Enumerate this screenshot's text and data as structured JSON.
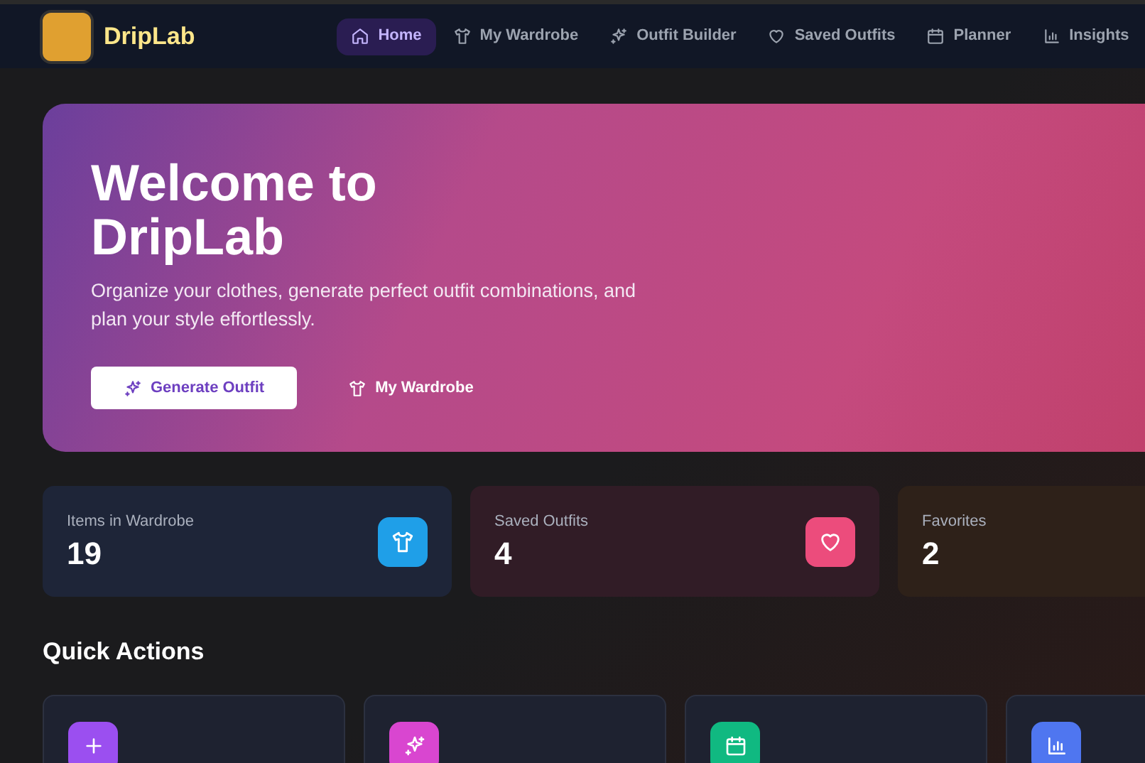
{
  "brand": {
    "name": "DripLab"
  },
  "nav": [
    {
      "label": "Home",
      "selected": true
    },
    {
      "label": "My Wardrobe",
      "selected": false
    },
    {
      "label": "Outfit Builder",
      "selected": false
    },
    {
      "label": "Saved Outfits",
      "selected": false
    },
    {
      "label": "Planner",
      "selected": false
    },
    {
      "label": "Insights",
      "selected": false
    }
  ],
  "hero": {
    "title": "Welcome to DripLab",
    "subtitle": "Organize your clothes, generate perfect outfit combinations, and plan your style effortlessly.",
    "primary_button": {
      "label": "Generate Outfit"
    },
    "secondary_button": {
      "label": "My Wardrobe"
    }
  },
  "stats": [
    {
      "label": "Items in Wardrobe",
      "value": "19",
      "color": "#1f9fe8"
    },
    {
      "label": "Saved Outfits",
      "value": "4",
      "color": "#ec4c7c"
    },
    {
      "label": "Favorites",
      "value": "2"
    }
  ],
  "quick_actions": {
    "title": "Quick Actions",
    "items": [
      {
        "color": "#9b4ff0"
      },
      {
        "color": "#d946d0"
      },
      {
        "color": "#10b981"
      },
      {
        "color": "#4f76f0"
      }
    ]
  }
}
